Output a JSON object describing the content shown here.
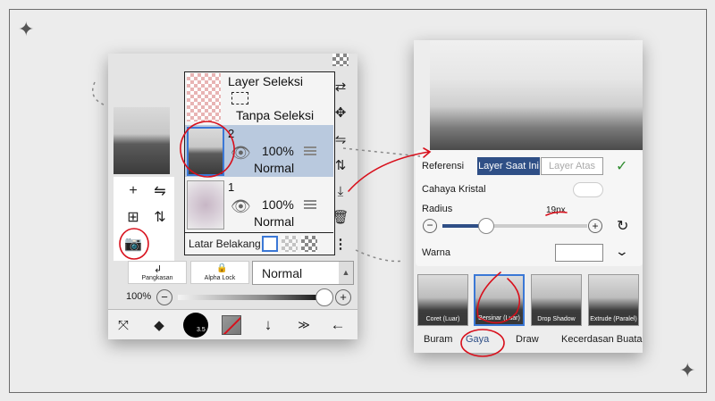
{
  "left_app": {
    "layers": {
      "selection": {
        "name": "Layer Seleksi",
        "status": "Tanpa Seleksi"
      },
      "layer2": {
        "number": "2",
        "opacity": "100%",
        "blend": "Normal"
      },
      "layer1": {
        "number": "1",
        "opacity": "100%",
        "blend": "Normal"
      },
      "background_label": "Latar Belakang"
    },
    "buttons": {
      "clipping": "Pangkasan",
      "alpha_lock": "Alpha Lock"
    },
    "blend_mode": "Normal",
    "opacity_label": "100%",
    "brush_size": "3.5"
  },
  "right_app": {
    "panel": {
      "reference_label": "Referensi",
      "reference_options": [
        "Layer Saat Ini",
        "Layer Atas"
      ],
      "crystal_label": "Cahaya Kristal",
      "radius_label": "Radius",
      "radius_value": "19px",
      "color_label": "Warna"
    },
    "filters": [
      "Coret (Luar)",
      "Bersinar (Luar)",
      "Drop Shadow",
      "Extrude (Paralel)"
    ],
    "tabs": [
      "Buram",
      "Gaya",
      "Draw",
      "Kecerdasan Buata"
    ]
  },
  "colors": {
    "accent_blue": "#2f4f86",
    "annotation_red": "#d8101c",
    "selected_layer": "#b9c9de"
  },
  "icons": [
    "sparkle-icon",
    "plus-icon",
    "flip-icon",
    "camera-icon",
    "eye-icon",
    "move-icon",
    "trash-icon",
    "check-icon",
    "refresh-icon",
    "chevron-down-icon",
    "eraser-icon",
    "arrow-down-icon",
    "arrow-left-icon"
  ]
}
